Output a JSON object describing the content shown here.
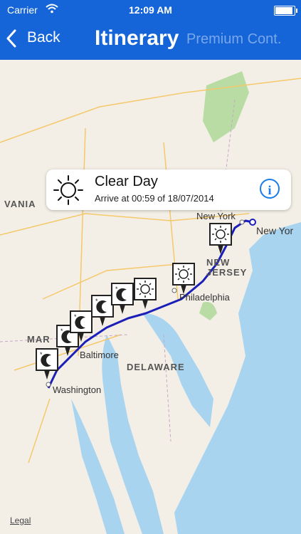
{
  "status_bar": {
    "carrier": "Carrier",
    "time": "12:09 AM"
  },
  "nav": {
    "back_label": "Back",
    "title": "Itinerary",
    "premium_label": "Premium Cont."
  },
  "map": {
    "labels": {
      "vania": "VANIA",
      "new_york_abbrev": "New York",
      "new_york": "New Yor",
      "new_jersey": "NEW JERSEY",
      "philadelphia": "Philadelphia",
      "maryland": "MAR",
      "baltimore": "Baltimore",
      "delaware": "DELAWARE",
      "washington": "Washington"
    },
    "legal": "Legal"
  },
  "callout": {
    "title": "Clear Day",
    "subtitle": "Arrive at 00:59 of 18/07/2014",
    "icon": "sun-icon",
    "info_icon": "info-icon"
  },
  "markers": [
    {
      "icon": "moon-stars-icon"
    },
    {
      "icon": "moon-stars-icon"
    },
    {
      "icon": "moon-stars-icon"
    },
    {
      "icon": "moon-stars-icon"
    },
    {
      "icon": "moon-stars-icon"
    },
    {
      "icon": "sun-icon"
    },
    {
      "icon": "sun-icon"
    },
    {
      "icon": "sun-icon"
    }
  ],
  "colors": {
    "nav_bg": "#1565d8",
    "route": "#1b1fb8",
    "water": "#a8d4f0",
    "land": "#f3efe6",
    "forest": "#b8dca4"
  }
}
